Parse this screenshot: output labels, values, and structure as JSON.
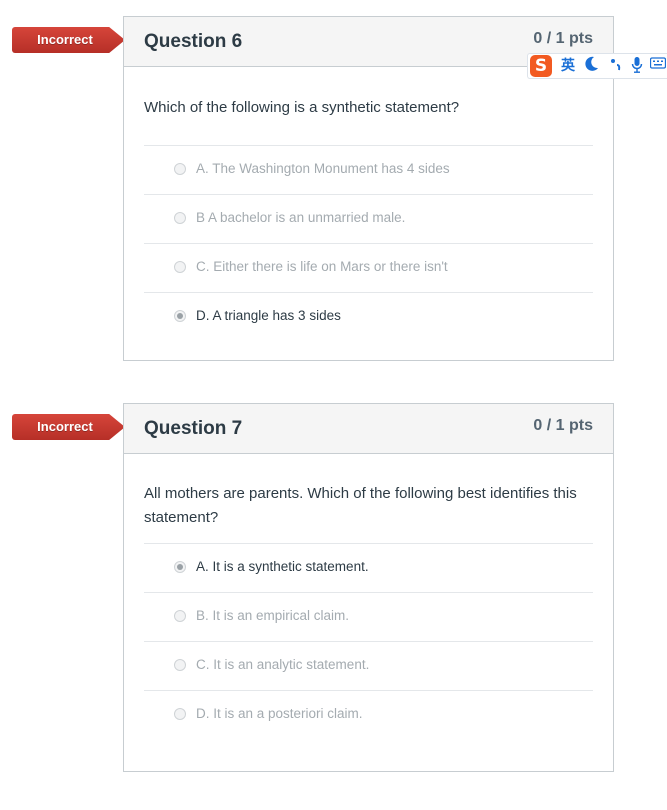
{
  "questions": [
    {
      "status": "Incorrect",
      "title": "Question 6",
      "points": "0 / 1 pts",
      "text": "Which of the following is a synthetic statement?",
      "answers": [
        {
          "label": "A. The Washington Monument has 4 sides",
          "selected": false
        },
        {
          "label": "B A bachelor is an unmarried male.",
          "selected": false
        },
        {
          "label": "C. Either there is life on Mars or there isn't",
          "selected": false
        },
        {
          "label": "D. A triangle has 3 sides",
          "selected": true
        }
      ]
    },
    {
      "status": "Incorrect",
      "title": "Question 7",
      "points": "0 / 1 pts",
      "text": "All mothers are parents. Which of the following best identifies this statement?",
      "answers": [
        {
          "label": "A. It is a synthetic statement.",
          "selected": true
        },
        {
          "label": "B. It is an empirical claim.",
          "selected": false
        },
        {
          "label": "C. It is an analytic statement.",
          "selected": false
        },
        {
          "label": "D. It is an a posteriori claim.",
          "selected": false
        }
      ]
    }
  ],
  "ime_toolbar": {
    "logo": "S",
    "language": "英",
    "icons": [
      "moon-icon",
      "punctuation-icon",
      "microphone-icon",
      "keyboard-icon"
    ]
  },
  "colors": {
    "incorrect_tag": "#c8392f",
    "header_bg": "#f5f5f5",
    "ime_accent": "#1a6fd6",
    "ime_logo": "#f25a21"
  }
}
